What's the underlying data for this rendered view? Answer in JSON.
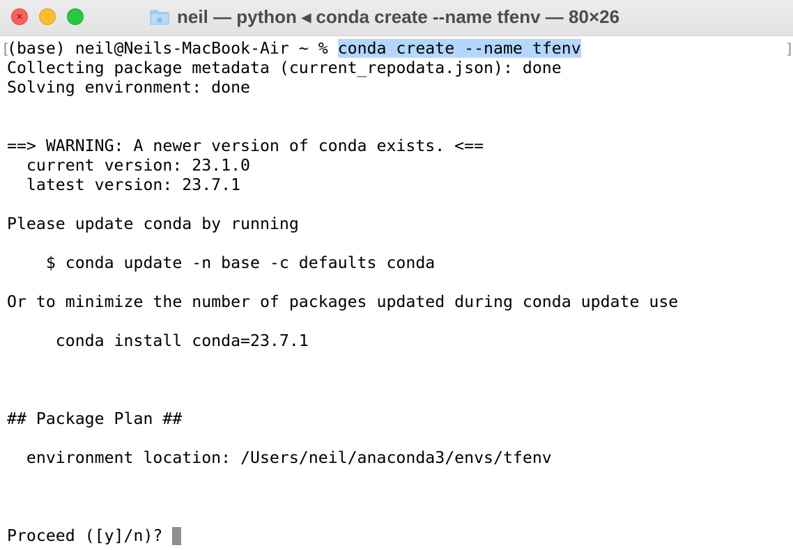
{
  "window": {
    "title": "neil — python ◂ conda create --name tfenv — 80×26",
    "folder_icon": "folder-icon"
  },
  "terminal": {
    "prompt": "(base) neil@Neils-MacBook-Air ~ % ",
    "command": "conda create --name tfenv",
    "lines": [
      "Collecting package metadata (current_repodata.json): done",
      "Solving environment: done",
      "",
      "",
      "==> WARNING: A newer version of conda exists. <==",
      "  current version: 23.1.0",
      "  latest version: 23.7.1",
      "",
      "Please update conda by running",
      "",
      "    $ conda update -n base -c defaults conda",
      "",
      "Or to minimize the number of packages updated during conda update use",
      "",
      "     conda install conda=23.7.1",
      "",
      "",
      "",
      "## Package Plan ##",
      "",
      "  environment location: /Users/neil/anaconda3/envs/tfenv",
      "",
      "",
      ""
    ],
    "final_prompt": "Proceed ([y]/n)? ",
    "selection_color": "#b3d7ff"
  }
}
